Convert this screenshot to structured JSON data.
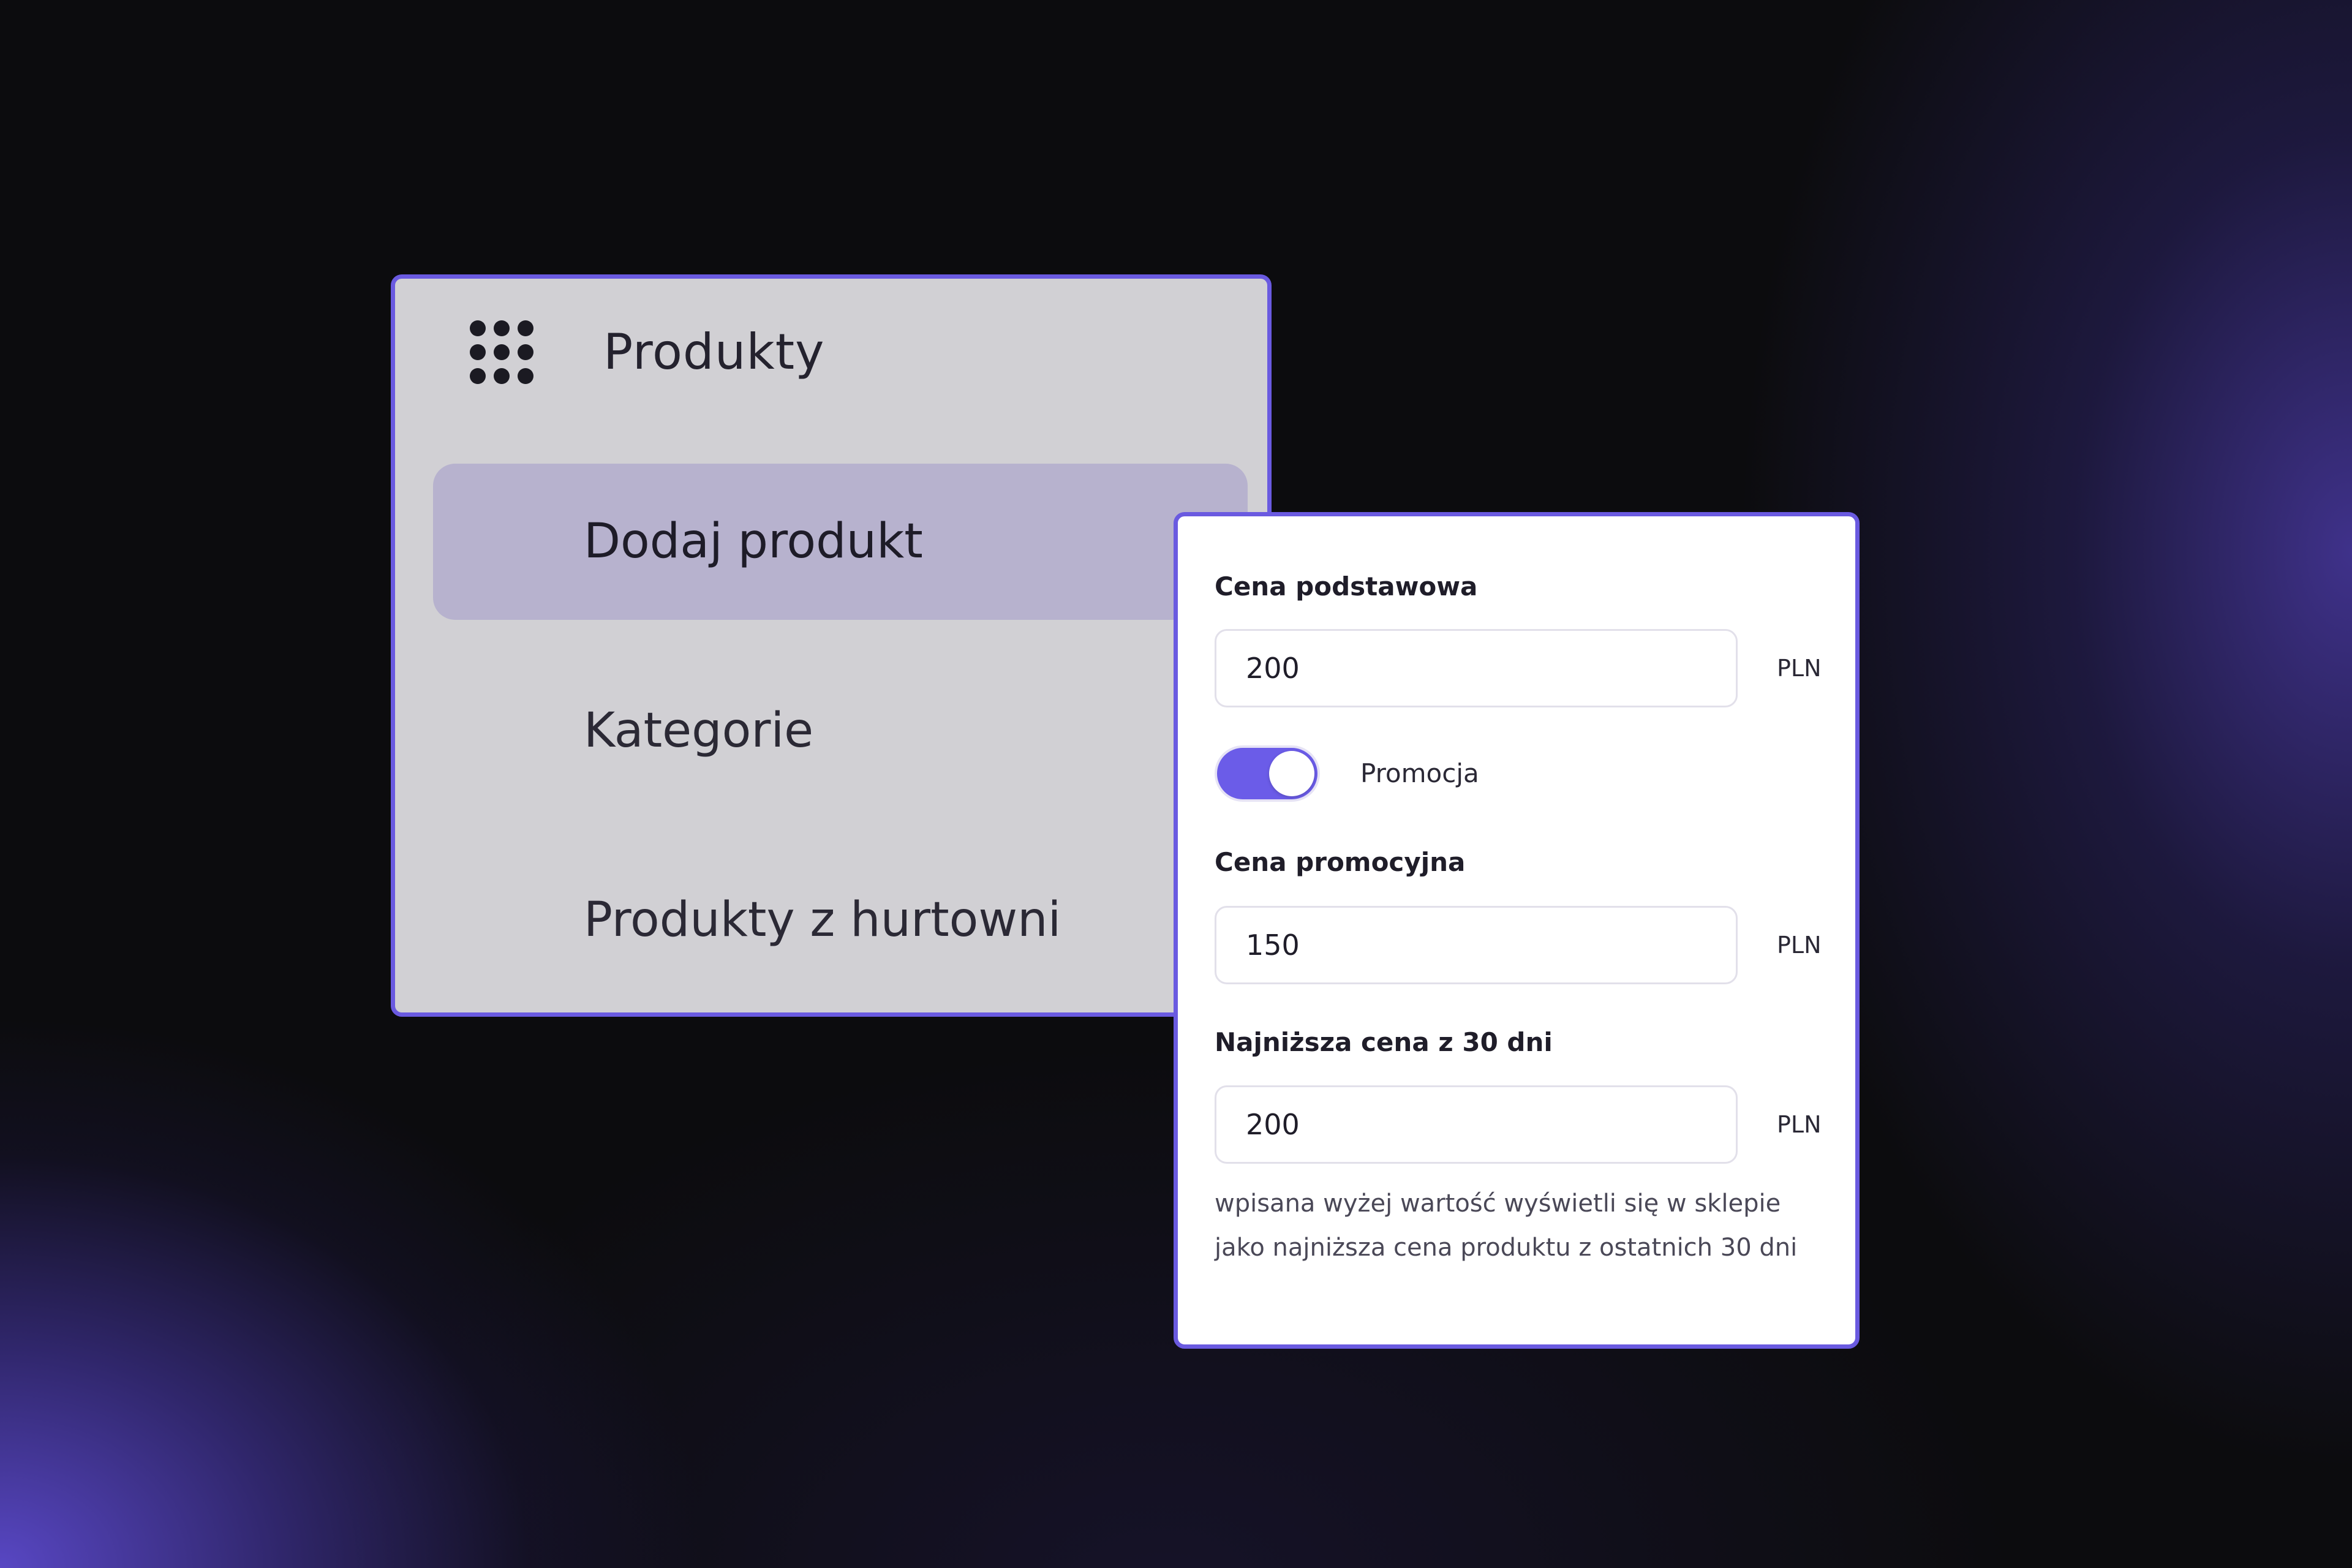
{
  "menu": {
    "title": "Produkty",
    "icon": "grid-dots-icon",
    "items": [
      {
        "label": "Dodaj produkt",
        "active": true
      },
      {
        "label": "Kategorie",
        "active": false
      },
      {
        "label": "Produkty z hurtowni",
        "active": false
      }
    ]
  },
  "price_panel": {
    "base_price": {
      "label": "Cena podstawowa",
      "value": "200",
      "unit": "PLN"
    },
    "promotion_toggle": {
      "label": "Promocja",
      "checked": true
    },
    "promo_price": {
      "label": "Cena promocyjna",
      "value": "150",
      "unit": "PLN"
    },
    "lowest_price": {
      "label": "Najniższa cena z 30 dni",
      "value": "200",
      "unit": "PLN"
    },
    "hint": "wpisana wyżej wartość wyświetli się w sklepie jako najniższa cena produktu z ostatnich 30 dni"
  },
  "colors": {
    "accent": "#6a5ae0",
    "toggle_on": "#6b5ce8",
    "menu_active_bg": "#b7b2ce",
    "menu_bg": "#d1d0d4",
    "page_bg": "#0c0c0e"
  }
}
